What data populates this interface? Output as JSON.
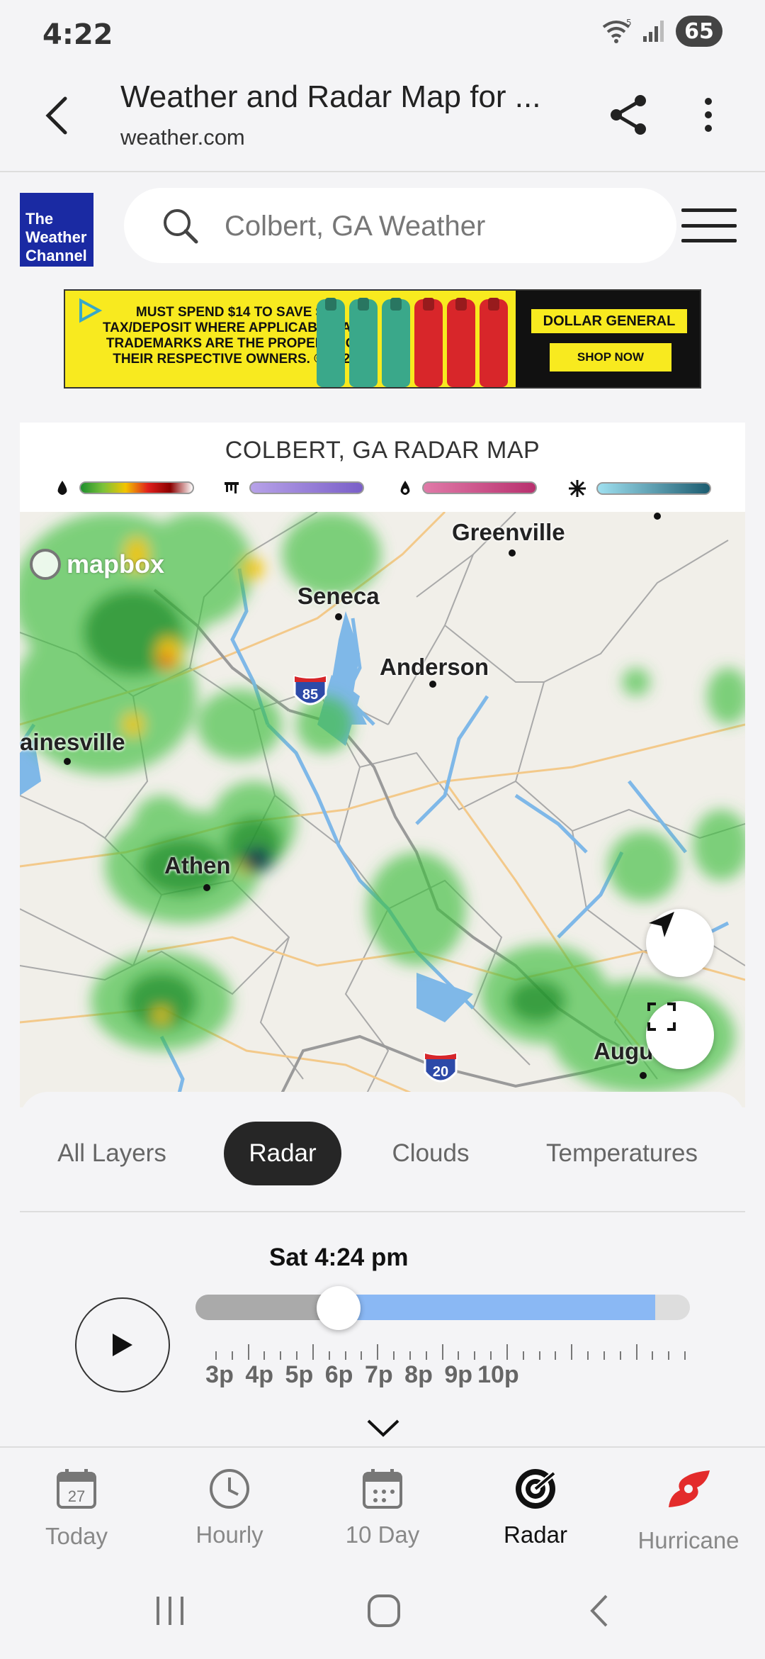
{
  "status_bar": {
    "time": "4:22",
    "battery": "65",
    "network": "5"
  },
  "browser": {
    "title": "Weather and Radar Map for ...",
    "url": "weather.com"
  },
  "site": {
    "logo_lines": [
      "The",
      "Weather",
      "Channel"
    ],
    "search_placeholder": "Colbert, GA Weather"
  },
  "ad": {
    "text": "MUST SPEND $14 TO SAVE $4. TAX/DEPOSIT WHERE APPLICABLE. ALL TRADEMARKS ARE THE PROPERTY OF THEIR RESPECTIVE OWNERS. © 2025",
    "brand": "DOLLAR GENERAL",
    "cta": "SHOP NOW"
  },
  "radar": {
    "title": "COLBERT, GA RADAR MAP",
    "legend": [
      {
        "icon": "rain-drop-icon",
        "colors": [
          "#1e8f2e",
          "#7bc23a",
          "#f2c400",
          "#e0201c",
          "#8b0000",
          "#ffffff"
        ]
      },
      {
        "icon": "ice-icon",
        "colors": [
          "#b7a2e8",
          "#7a5fc8"
        ]
      },
      {
        "icon": "mix-icon",
        "colors": [
          "#e07aa8",
          "#b8306e"
        ]
      },
      {
        "icon": "snowflake-icon",
        "colors": [
          "#9fe0f0",
          "#1c5c70"
        ]
      }
    ]
  },
  "map": {
    "attribution": "mapbox",
    "labels": [
      "Greenville",
      "Seneca",
      "Anderson",
      "ainesville",
      "Athen",
      "Augu"
    ],
    "interstates": [
      "85",
      "20"
    ]
  },
  "layers": {
    "tabs": [
      "All Layers",
      "Radar",
      "Clouds",
      "Temperatures"
    ],
    "active": "Radar"
  },
  "timeline": {
    "current": "Sat 4:24 pm",
    "hours": [
      "3p",
      "4p",
      "5p",
      "6p",
      "7p",
      "8p",
      "9p",
      "10p"
    ],
    "position": 0.29,
    "future_start": 0.29,
    "future_end": 0.93
  },
  "bottom_nav": {
    "items": [
      "Today",
      "Hourly",
      "10 Day",
      "Radar",
      "Hurricane"
    ],
    "today_date": "27",
    "active": "Radar"
  }
}
